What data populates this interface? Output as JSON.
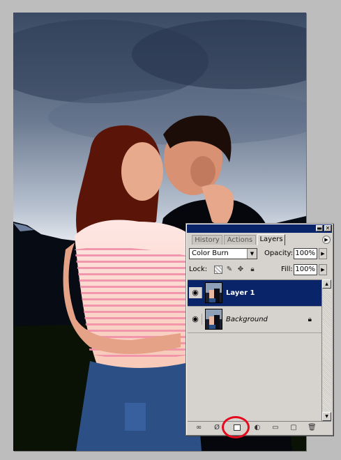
{
  "palette": {
    "tabs": [
      "History",
      "Actions",
      "Layers"
    ],
    "active_tab": "Layers",
    "blend_mode": "Color Burn",
    "opacity_label": "Opacity:",
    "opacity_value": "100%",
    "lock_label": "Lock:",
    "fill_label": "Fill:",
    "fill_value": "100%",
    "layers": [
      {
        "name": "Layer 1",
        "selected": true,
        "visible": true,
        "locked": false
      },
      {
        "name": "Background",
        "selected": false,
        "visible": true,
        "locked": true
      }
    ],
    "bottom_icons": [
      "link-icon",
      "layer-style-icon",
      "add-mask-icon",
      "adjustment-layer-icon",
      "new-group-icon",
      "new-layer-icon",
      "trash-icon"
    ],
    "highlighted_icon": "add-mask-icon"
  },
  "colors": {
    "title_bar": "#0a246a",
    "selection": "#0a246a",
    "highlight_circle": "#e4091d",
    "panel_bg": "#d6d3ce"
  }
}
